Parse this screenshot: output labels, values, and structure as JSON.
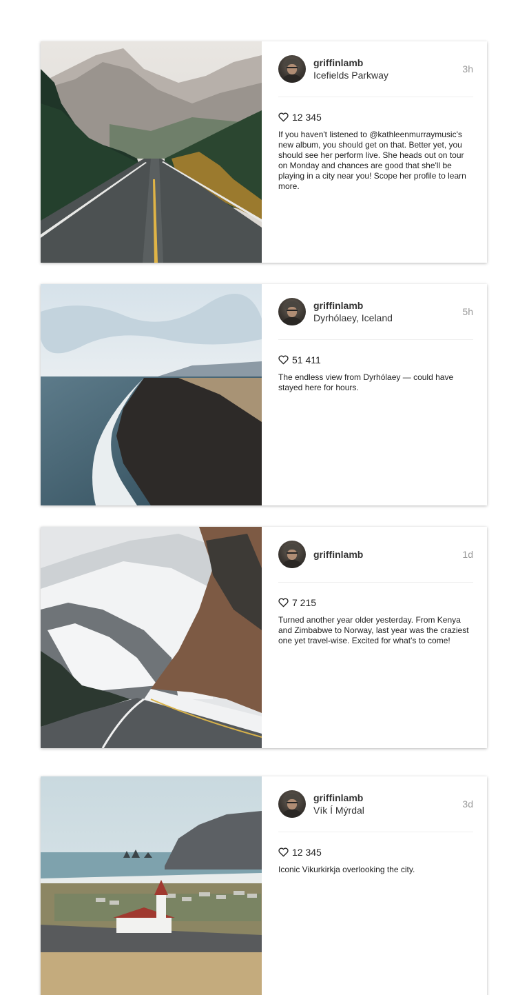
{
  "posts": [
    {
      "username": "griffinlamb",
      "location": "Icefields Parkway",
      "time": "3h",
      "likes": "12 345",
      "caption": "If you haven't listened to @kathleenmurraymusic's new album, you should get on that. Better yet, you should see her perform live. She heads out on tour on Monday and chances are good that she'll be playing in a city near you! Scope her profile to learn more."
    },
    {
      "username": "griffinlamb",
      "location": "Dyrhólaey, Iceland",
      "time": "5h",
      "likes": "51 411",
      "caption": "The endless view from Dyrhólaey — could have stayed here for hours."
    },
    {
      "username": "griffinlamb",
      "location": "",
      "time": "1d",
      "likes": "7 215",
      "caption": "Turned another year older yesterday. From Kenya and Zimbabwe to Norway, last year was the craziest one yet travel-wise. Excited for what's to come!"
    },
    {
      "username": "griffinlamb",
      "location": "Vík Í Mýrdal",
      "time": "3d",
      "likes": "12 345",
      "caption": "Iconic Vikurkirkja overlooking the city."
    }
  ],
  "icons": {
    "like": "heart-outline-icon",
    "avatar": "user-avatar"
  },
  "colors": {
    "timestamp": "#999999",
    "divider": "#efefef",
    "text": "#222222"
  }
}
